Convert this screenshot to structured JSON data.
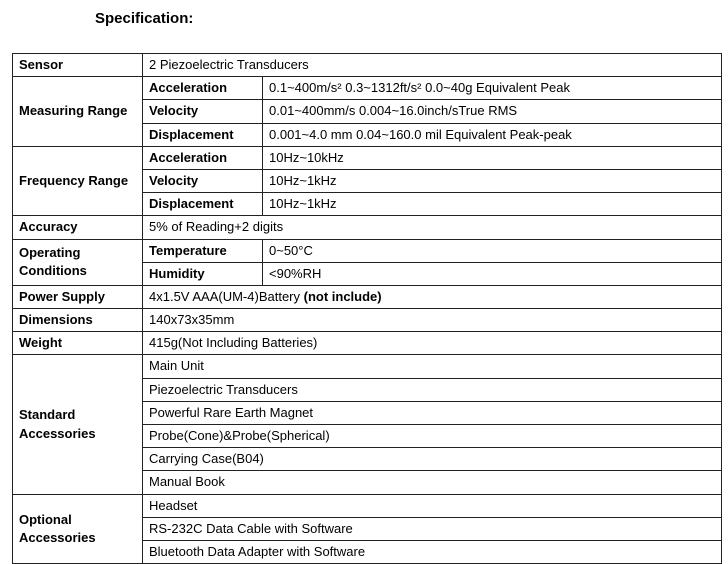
{
  "title": "Specification:",
  "rows": {
    "sensor": {
      "label": "Sensor",
      "value": "2 Piezoelectric Transducers"
    },
    "measuring_range": {
      "label": "Measuring Range",
      "items": [
        {
          "label": "Acceleration",
          "value": "0.1~400m/s² 0.3~1312ft/s² 0.0~40g Equivalent Peak"
        },
        {
          "label": "Velocity",
          "value": "0.01~400mm/s 0.004~16.0inch/sTrue RMS"
        },
        {
          "label": "Displacement",
          "value": "0.001~4.0 mm 0.04~160.0 mil Equivalent Peak-peak"
        }
      ]
    },
    "frequency_range": {
      "label": "Frequency Range",
      "items": [
        {
          "label": "Acceleration",
          "value": "10Hz~10kHz"
        },
        {
          "label": "Velocity",
          "value": "10Hz~1kHz"
        },
        {
          "label": "Displacement",
          "value": "10Hz~1kHz"
        }
      ]
    },
    "accuracy": {
      "label": "Accuracy",
      "value": "5% of Reading+2 digits"
    },
    "operating_conditions": {
      "label": "Operating Conditions",
      "items": [
        {
          "label": "Temperature",
          "value": "0~50°C"
        },
        {
          "label": "Humidity",
          "value": "<90%RH"
        }
      ]
    },
    "power_supply": {
      "label": "Power Supply",
      "value_pre": "4x1.5V AAA(UM-4)Battery ",
      "value_bold": "(not include)"
    },
    "dimensions": {
      "label": "Dimensions",
      "value": "140x73x35mm"
    },
    "weight": {
      "label": "Weight",
      "value": "415g(Not Including Batteries)"
    },
    "standard_accessories": {
      "label": "Standard Accessories",
      "items": [
        "Main Unit",
        "Piezoelectric Transducers",
        "Powerful Rare Earth Magnet",
        "Probe(Cone)&Probe(Spherical)",
        "Carrying Case(B04)",
        "Manual Book"
      ]
    },
    "optional_accessories": {
      "label": "Optional Accessories",
      "items": [
        "Headset",
        "RS-232C Data Cable with Software",
        "Bluetooth Data Adapter with Software"
      ]
    }
  }
}
